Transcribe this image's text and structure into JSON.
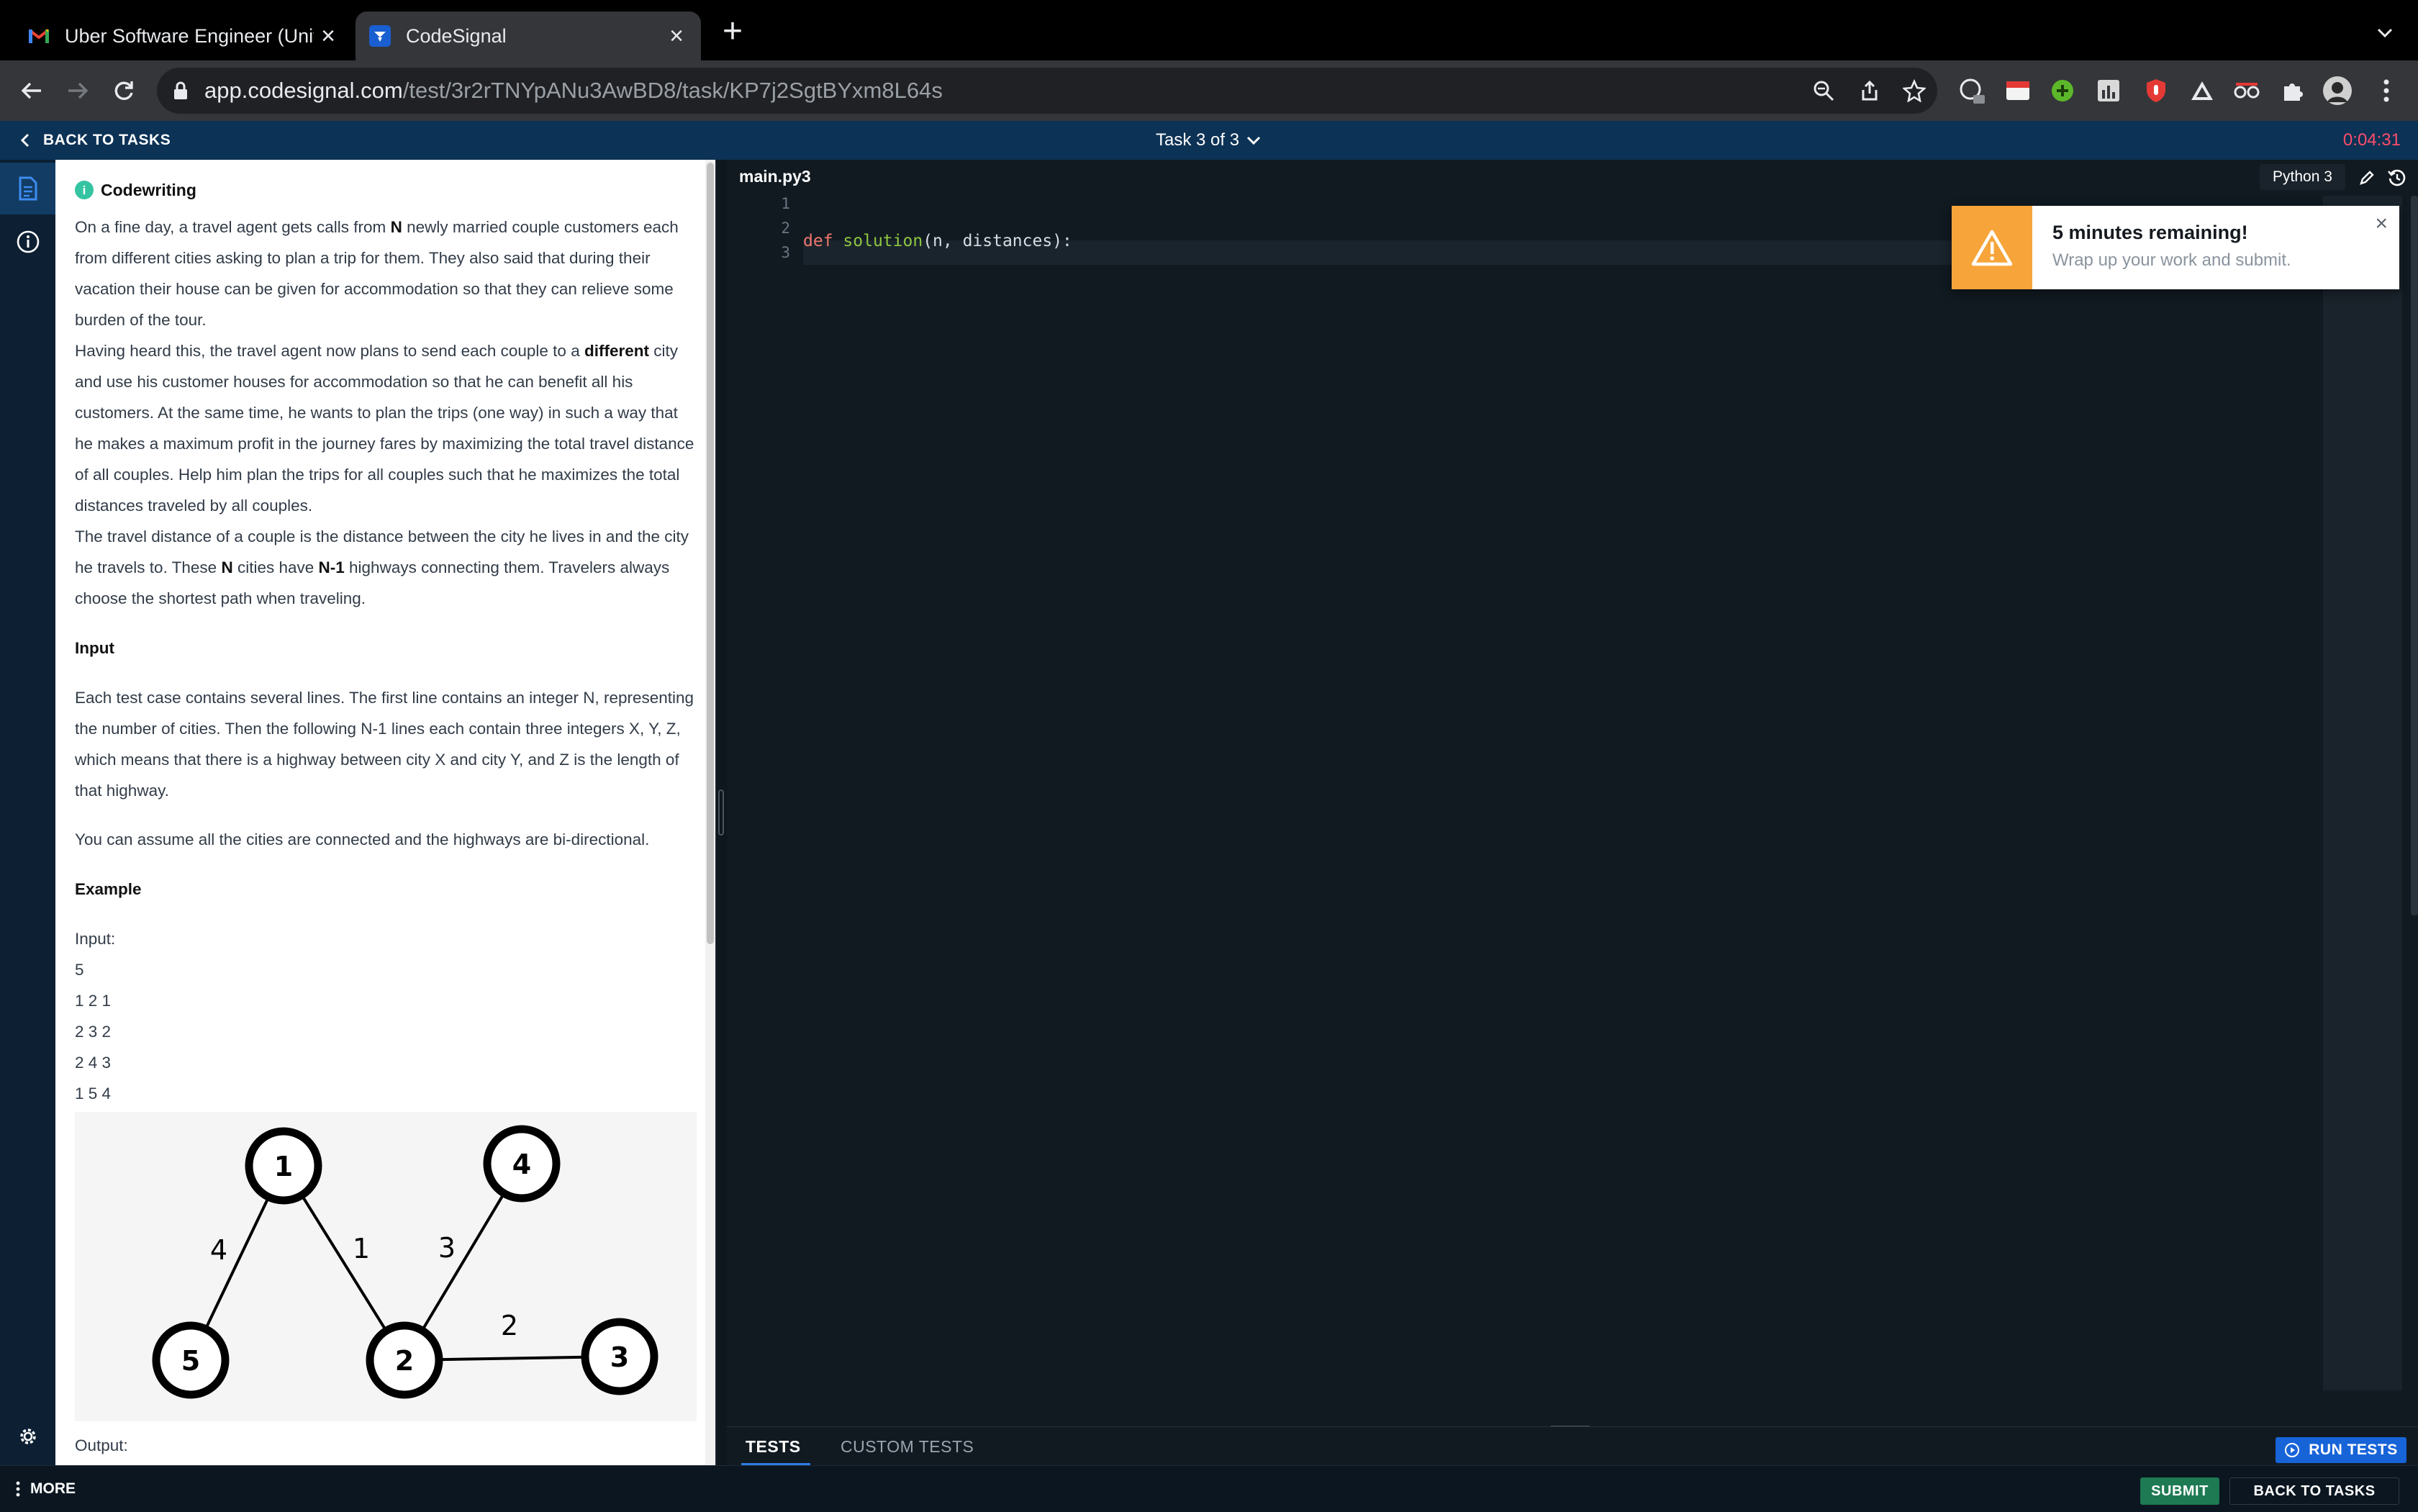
{
  "browser": {
    "tabs": [
      {
        "title": "Uber Software Engineer (Unive",
        "favicon": "gmail-icon"
      },
      {
        "title": "CodeSignal",
        "favicon": "codesignal-icon"
      }
    ],
    "url_host": "app.codesignal.com",
    "url_path": "/test/3r2rTNYpANu3AwBD8/task/KP7j2SgtBYxm8L64s"
  },
  "header": {
    "back_label": "BACK TO TASKS",
    "task_label": "Task 3 of 3",
    "timer": "0:04:31"
  },
  "problem": {
    "type_label": "Codewriting",
    "p1": {
      "a": "On a fine day, a travel agent gets calls from ",
      "b": "N",
      "c": " newly married couple customers each from different cities asking to plan a trip for them. They also said that during their vacation their house can be given for accommodation so that they can relieve some burden of the tour."
    },
    "p2": {
      "a": "Having heard this, the travel agent now plans to send each couple to a ",
      "b": "different",
      "c": " city and use his customer houses for accommodation so that he can benefit all his customers. At the same time, he wants to plan the trips (one way) in such a way that he makes a maximum profit in the journey fares by maximizing the total travel distance of all couples. Help him plan the trips for all couples such that he maximizes the total distances traveled by all couples."
    },
    "p3": {
      "a": "The travel distance of a couple is the distance between the city he lives in and the city he travels to. These ",
      "b": "N",
      "c": " cities have ",
      "d": "N-1",
      "e": " highways connecting them. Travelers always choose the shortest path when traveling."
    },
    "input_heading": "Input",
    "input_text": "Each test case contains several lines. The first line contains an integer N, representing the number of cities. Then the following N-1 lines each contain three integers X, Y, Z, which means that there is a highway between city X and city Y, and Z is the length of that highway.",
    "assume_text": "You can assume all the cities are connected and the highways are bi-directional.",
    "example_heading": "Example",
    "example_input_label": "Input:",
    "example_lines": [
      "5",
      "1 2 1",
      "2 3 2",
      "2 4 3",
      "1 5 4"
    ],
    "graph": {
      "nodes": [
        "1",
        "2",
        "3",
        "4",
        "5"
      ],
      "edge_labels": [
        "4",
        "1",
        "3",
        "2"
      ]
    },
    "output_label": "Output:"
  },
  "editor": {
    "filename": "main.py3",
    "language": "Python 3",
    "line_numbers": [
      "1",
      "2",
      "3"
    ],
    "code": {
      "kw": "def",
      "fn": "solution",
      "rest": "(n, distances):"
    }
  },
  "toast": {
    "title": "5 minutes remaining!",
    "message": "Wrap up your work and submit."
  },
  "tests": {
    "tab_tests": "TESTS",
    "tab_custom": "CUSTOM TESTS",
    "run_label": "RUN TESTS"
  },
  "footer": {
    "more_label": "MORE",
    "submit_label": "SUBMIT",
    "back_label": "BACK TO TASKS"
  },
  "colors": {
    "header_bg": "#0c3255",
    "timer": "#ff4d6a",
    "run_button": "#1764d8",
    "submit_button": "#1e7a52",
    "toast_accent": "#f7a53a",
    "keyword": "#f0776d",
    "function_name": "#8ec641"
  }
}
